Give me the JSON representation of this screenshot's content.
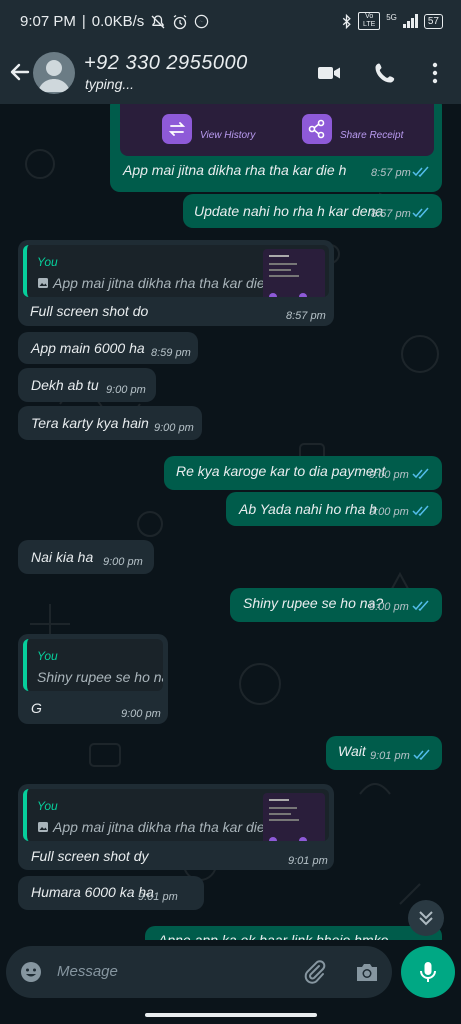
{
  "status_bar": {
    "time": "9:07 PM",
    "speed": "0.0KB/s",
    "network": "5G",
    "volte": "Vo LTE",
    "battery": "57"
  },
  "header": {
    "contact_name": "+92 330 2955000",
    "status": "typing..."
  },
  "receipt_card": {
    "view_history": "View History",
    "share_receipt": "Share Receipt"
  },
  "messages": [
    {
      "text": "App mai jitna dikha rha tha kar die h",
      "time": "8:57 pm"
    },
    {
      "text": "Update nahi ho rha h kar dena",
      "time": "8:57 pm"
    },
    {
      "quote_author": "You",
      "quote_text": "App mai jitna dikha rha tha kar die h",
      "text": "Full screen shot do",
      "time": "8:57 pm"
    },
    {
      "text": "App main 6000 ha",
      "time": "8:59 pm"
    },
    {
      "text": "Dekh ab tu",
      "time": "9:00 pm"
    },
    {
      "text": "Tera karty kya hain",
      "time": "9:00 pm"
    },
    {
      "text": "Re kya karoge kar to dia payment",
      "time": "9:00 pm"
    },
    {
      "text": "Ab Yada nahi ho rha h",
      "time": "9:00 pm"
    },
    {
      "text": "Nai kia ha",
      "time": "9:00 pm"
    },
    {
      "text": "Shiny rupee se ho na?",
      "time": "9:00 pm"
    },
    {
      "quote_author": "You",
      "quote_text": "Shiny rupee se ho na?",
      "text": "G",
      "time": "9:00 pm"
    },
    {
      "text": "Wait",
      "time": "9:01 pm"
    },
    {
      "quote_author": "You",
      "quote_text": "App mai jitna dikha rha tha kar die h",
      "text": "Full screen shot dy",
      "time": "9:01 pm"
    },
    {
      "text": "Humara 6000 ka ha",
      "time": "9:01 pm"
    },
    {
      "text": "Apne app ka ek baar link bhejo hmko"
    }
  ],
  "input": {
    "placeholder": "Message"
  },
  "colors": {
    "outgoing": "#005c4b",
    "incoming": "#1f2c34",
    "accent": "#00a884",
    "read_ticks": "#53bdeb"
  }
}
